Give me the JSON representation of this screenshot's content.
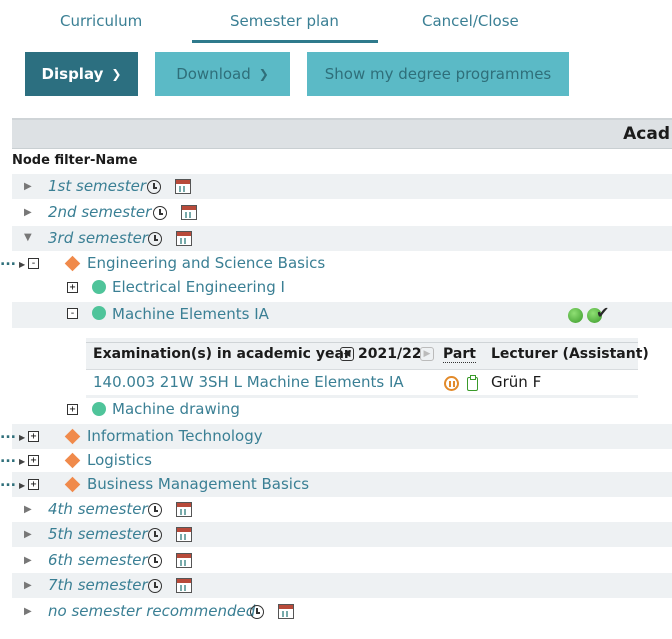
{
  "tabs": {
    "curriculum": "Curriculum",
    "semester_plan": "Semester plan",
    "cancel_close": "Cancel/Close"
  },
  "buttons": {
    "display": "Display",
    "download": "Download",
    "show_degree": "Show my degree programmes"
  },
  "header": {
    "band_title": "Acad",
    "node_filter_label": "Node filter-Name"
  },
  "semesters_top": [
    "1st semester",
    "2nd semester",
    "3rd semester"
  ],
  "nodes": {
    "engineering": "Engineering and Science Basics",
    "electrical": "Electrical Engineering I",
    "machine_elements": "Machine Elements IA",
    "machine_drawing": "Machine drawing",
    "information_technology": "Information Technology",
    "logistics": "Logistics",
    "business": "Business Management Basics"
  },
  "exam_table": {
    "col_exam": "Examination(s) in academic year",
    "year": "2021/22",
    "col_part": "Part",
    "col_lecturer": "Lecturer (Assistant)",
    "row_course": "140.003 21W 3SH L Machine Elements IA",
    "row_lecturer": "Grün F"
  },
  "semesters_bottom": [
    "4th semester",
    "5th semester",
    "6th semester",
    "7th semester",
    "no semester recommended"
  ],
  "icons": {
    "expand": "+",
    "collapse": "-",
    "more": "..."
  },
  "colors": {
    "accent_dark": "#2c6f80",
    "accent_light": "#5bbac6",
    "link": "#3a7f94",
    "node_orange": "#f08a4b",
    "node_green": "#4fc49a"
  }
}
